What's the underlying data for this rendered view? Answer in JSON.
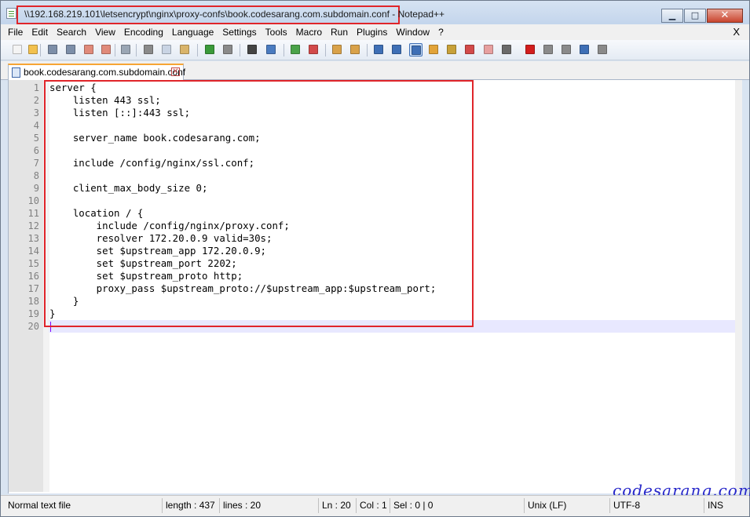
{
  "window": {
    "title": "\\\\192.168.219.101\\letsencrypt\\nginx\\proxy-confs\\book.codesarang.com.subdomain.conf - Notepad++",
    "minimize_glyph": "▁",
    "maximize_glyph": "□",
    "close_glyph": "✕"
  },
  "menu": {
    "items": [
      "File",
      "Edit",
      "Search",
      "View",
      "Encoding",
      "Language",
      "Settings",
      "Tools",
      "Macro",
      "Run",
      "Plugins",
      "Window",
      "?"
    ],
    "close_label": "X"
  },
  "toolbar": {
    "buttons": [
      {
        "name": "new-file-icon",
        "color": "#f4f4f4"
      },
      {
        "name": "open-file-icon",
        "color": "#f2c14e"
      },
      {
        "name": "save-icon",
        "color": "#7c8ea8"
      },
      {
        "name": "save-all-icon",
        "color": "#7c8ea8"
      },
      {
        "name": "close-icon",
        "color": "#e08a7a"
      },
      {
        "name": "close-all-icon",
        "color": "#e08a7a"
      },
      {
        "name": "print-icon",
        "color": "#9aa6b4"
      },
      {
        "name": "cut-icon",
        "color": "#8a8a8a"
      },
      {
        "name": "copy-icon",
        "color": "#c9d4e4"
      },
      {
        "name": "paste-icon",
        "color": "#d9b46a"
      },
      {
        "name": "undo-icon",
        "color": "#3a9a3a"
      },
      {
        "name": "redo-icon",
        "color": "#8a8a8a"
      },
      {
        "name": "find-icon",
        "color": "#444444"
      },
      {
        "name": "replace-icon",
        "color": "#4a7bc0"
      },
      {
        "name": "zoom-in-icon",
        "color": "#4aa34a"
      },
      {
        "name": "zoom-out-icon",
        "color": "#d24a4a"
      },
      {
        "name": "sync-vertical-icon",
        "color": "#d9a24a"
      },
      {
        "name": "sync-horizontal-icon",
        "color": "#d9a24a"
      },
      {
        "name": "word-wrap-icon",
        "color": "#3e6fb6"
      },
      {
        "name": "show-all-chars-icon",
        "color": "#3e6fb6"
      },
      {
        "name": "indent-guide-icon",
        "color": "#3e6fb6"
      },
      {
        "name": "user-language-icon",
        "color": "#e2a43a"
      },
      {
        "name": "document-map-icon",
        "color": "#c7a13a"
      },
      {
        "name": "function-list-icon",
        "color": "#d24a4a"
      },
      {
        "name": "folder-workspace-icon",
        "color": "#e7a0a0"
      },
      {
        "name": "monitoring-icon",
        "color": "#6a6a6a"
      },
      {
        "name": "record-macro-icon",
        "color": "#d21e1e"
      },
      {
        "name": "stop-macro-icon",
        "color": "#8a8a8a"
      },
      {
        "name": "play-macro-icon",
        "color": "#8a8a8a"
      },
      {
        "name": "run-macro-multiple-icon",
        "color": "#3e6fb6"
      },
      {
        "name": "save-macro-icon",
        "color": "#8a8a8a"
      }
    ]
  },
  "tab": {
    "label": "book.codesarang.com.subdomain.conf",
    "close_glyph": "✕"
  },
  "editor": {
    "line_numbers": [
      "1",
      "2",
      "3",
      "4",
      "5",
      "6",
      "7",
      "8",
      "9",
      "10",
      "11",
      "12",
      "13",
      "14",
      "15",
      "16",
      "17",
      "18",
      "19",
      "20"
    ],
    "lines": [
      "server {",
      "    listen 443 ssl;",
      "    listen [::]:443 ssl;",
      "",
      "    server_name book.codesarang.com;",
      "",
      "    include /config/nginx/ssl.conf;",
      "",
      "    client_max_body_size 0;",
      "",
      "    location / {",
      "        include /config/nginx/proxy.conf;",
      "        resolver 172.20.0.9 valid=30s;",
      "        set $upstream_app 172.20.0.9;",
      "        set $upstream_port 2202;",
      "        set $upstream_proto http;",
      "        proxy_pass $upstream_proto://$upstream_app:$upstream_port;",
      "    }",
      "}",
      ""
    ]
  },
  "watermark": "codesarang.com",
  "status": {
    "file_type": "Normal text file",
    "length": "length : 437",
    "lines": "lines : 20",
    "ln": "Ln : 20",
    "col": "Col : 1",
    "sel": "Sel : 0 | 0",
    "eol": "Unix (LF)",
    "encoding": "UTF-8",
    "mode": "INS"
  },
  "colors": {
    "highlight_box": "#e0252a",
    "caret_line": "#e8e8ff",
    "watermark": "#2727c9"
  }
}
